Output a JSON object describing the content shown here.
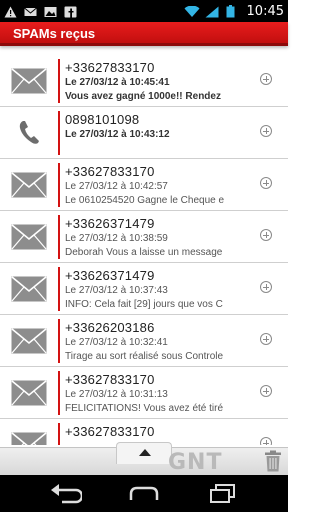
{
  "status_bar": {
    "time": "10:45",
    "left_icons": [
      "warning-icon",
      "mail-icon",
      "image-icon",
      "facebook-icon"
    ],
    "right_icons": [
      "wifi-icon",
      "signal-icon",
      "battery-icon"
    ]
  },
  "header": {
    "title": "SPAMs reçus",
    "accent_color": "#d31212"
  },
  "messages": [
    {
      "type": "sms",
      "number": "+33627833170",
      "date": "Le 27/03/12 à 10:45:41",
      "preview": "Vous avez gagné 1000e!! Rendez",
      "unread": true
    },
    {
      "type": "call",
      "number": "0898101098",
      "date": "Le 27/03/12 à 10:43:12",
      "preview": "",
      "unread": true
    },
    {
      "type": "sms",
      "number": "+33627833170",
      "date": "Le 27/03/12 à 10:42:57",
      "preview": "Le 0610254520 Gagne le Cheque e",
      "unread": false
    },
    {
      "type": "sms",
      "number": "+33626371479",
      "date": "Le 27/03/12 à 10:38:59",
      "preview": "Deborah Vous a laisse un message",
      "unread": false
    },
    {
      "type": "sms",
      "number": "+33626371479",
      "date": "Le 27/03/12 à 10:37:43",
      "preview": "INFO: Cela fait [29] jours que vos C",
      "unread": false
    },
    {
      "type": "sms",
      "number": "+33626203186",
      "date": "Le 27/03/12 à 10:32:41",
      "preview": "Tirage au sort réalisé sous Controle",
      "unread": false
    },
    {
      "type": "sms",
      "number": "+33627833170",
      "date": "Le 27/03/12 à 10:31:13",
      "preview": "FELICITATIONS! Vous avez été tiré",
      "unread": false
    },
    {
      "type": "sms",
      "number": "+33627833170",
      "date": "",
      "preview": "",
      "unread": false
    }
  ],
  "toolbar": {
    "watermark": "GNT"
  }
}
